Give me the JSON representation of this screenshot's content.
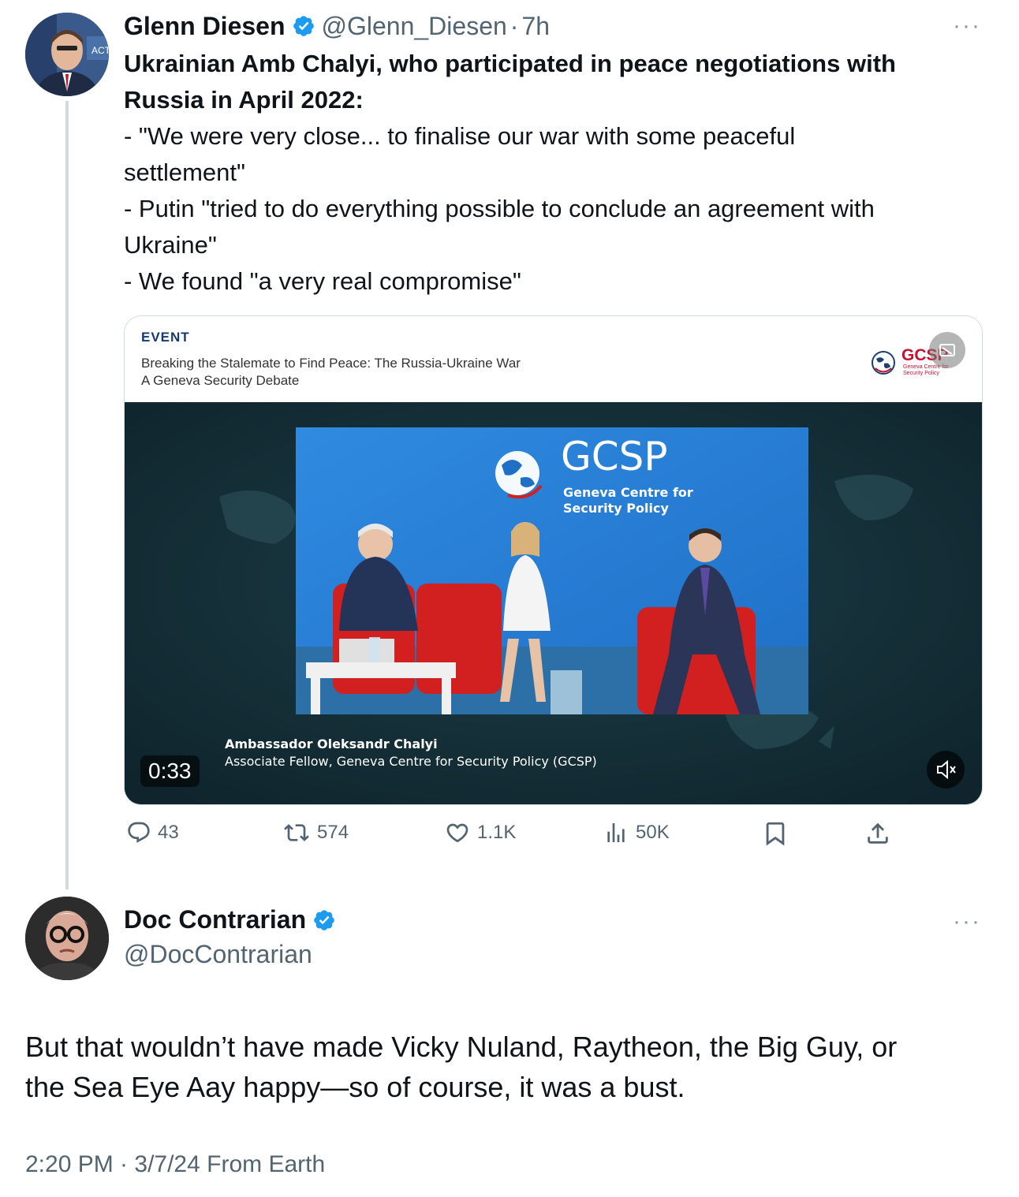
{
  "tweet1": {
    "author_name": "Glenn Diesen",
    "handle": "@Glenn_Diesen",
    "separator": "·",
    "time": "7h",
    "more": "···",
    "headline_line1": "Ukrainian Amb Chalyi, who participated in peace negotiations with",
    "headline_line2": "Russia in April 2022:",
    "body_lines": [
      "- \"We were very close... to finalise our war with some peaceful",
      "settlement\"",
      "- Putin \"tried to do everything possible to conclude an agreement with",
      "Ukraine\"",
      "- We found \"a very real compromise\""
    ],
    "avatar_text": "ACTU"
  },
  "media": {
    "event_label": "EVENT",
    "event_title": "Breaking the Stalemate to Find Peace: The Russia-Ukraine War",
    "event_subtitle": "A Geneva Security Debate",
    "logo_text": "GCSP",
    "logo_sub": "Geneva Centre for Security Policy",
    "banner_title": "GCSP",
    "banner_sub1": "Geneva Centre for",
    "banner_sub2": "Security Policy",
    "speaker_name": "Ambassador Oleksandr Chalyi",
    "speaker_role": "Associate Fellow, Geneva Centre for Security Policy (GCSP)",
    "duration": "0:33"
  },
  "actions": {
    "replies": "43",
    "reposts": "574",
    "likes": "1.1K",
    "views": "50K"
  },
  "tweet2": {
    "author_name": "Doc Contrarian",
    "handle": "@DocContrarian",
    "more": "···",
    "text_line1": "But that wouldn’t have made Vicky Nuland, Raytheon, the Big Guy, or",
    "text_line2": "the Sea Eye Aay happy—so of course, it was a bust.",
    "meta": "2:20 PM · 3/7/24 From Earth"
  },
  "colors": {
    "verified": "#1d9bf0",
    "muted": "#536471",
    "banner_blue": "#1f78d1",
    "chair_red": "#d21f1f"
  }
}
